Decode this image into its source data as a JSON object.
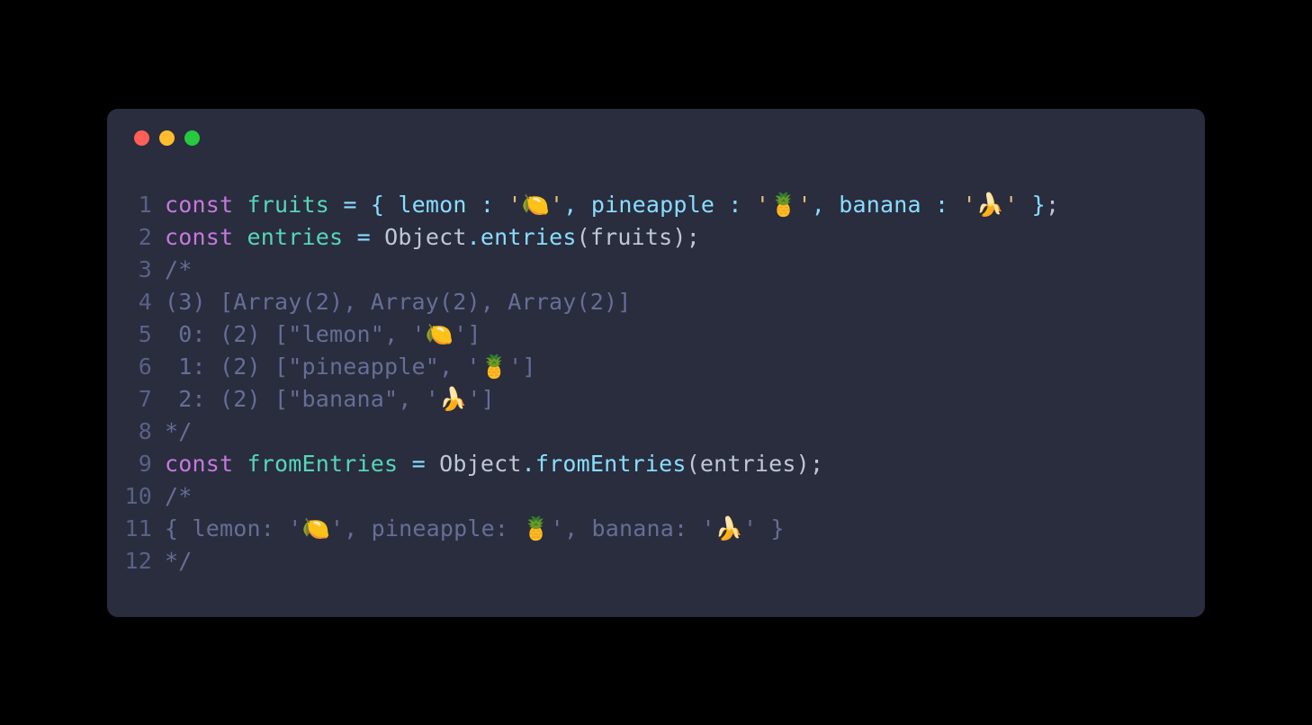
{
  "titlebar": {
    "close": "close",
    "minimize": "minimize",
    "zoom": "zoom"
  },
  "lines": [
    {
      "num": "1"
    },
    {
      "num": "2"
    },
    {
      "num": "3"
    },
    {
      "num": "4"
    },
    {
      "num": "5"
    },
    {
      "num": "6"
    },
    {
      "num": "7"
    },
    {
      "num": "8"
    },
    {
      "num": "9"
    },
    {
      "num": "10"
    },
    {
      "num": "11"
    },
    {
      "num": "12"
    }
  ],
  "tokens": {
    "l1": {
      "const": "const",
      "sp1": " ",
      "fruits": "fruits",
      "sp2": " ",
      "eq": "=",
      "sp3": " ",
      "obrace": "{",
      "sp4": " ",
      "lemon": "lemon",
      "sp5": " ",
      "colon1": ":",
      "sp6": " ",
      "str1": "'🍋'",
      "comma1": ",",
      "sp7": " ",
      "pineapple": "pineapple",
      "sp8": " ",
      "colon2": ":",
      "sp9": " ",
      "str2": "'🍍'",
      "comma2": ",",
      "sp10": " ",
      "banana": "banana",
      "sp11": " ",
      "colon3": ":",
      "sp12": " ",
      "str3": "'🍌'",
      "sp13": " ",
      "cbrace": "}",
      "semi": ";"
    },
    "l2": {
      "const": "const",
      "sp1": " ",
      "entries": "entries",
      "sp2": " ",
      "eq": "=",
      "sp3": " ",
      "object": "Object",
      "dot": ".",
      "method": "entries",
      "oparen": "(",
      "arg": "fruits",
      "cparen": ")",
      "semi": ";"
    },
    "l3": {
      "text": "/*"
    },
    "l4": {
      "text": "(3) [Array(2), Array(2), Array(2)]"
    },
    "l5": {
      "text": " 0: (2) [\"lemon\", '🍋']"
    },
    "l6": {
      "text": " 1: (2) [\"pineapple\", '🍍']"
    },
    "l7": {
      "text": " 2: (2) [\"banana\", '🍌']"
    },
    "l8": {
      "text": "*/"
    },
    "l9": {
      "const": "const",
      "sp1": " ",
      "fromEntries": "fromEntries",
      "sp2": " ",
      "eq": "=",
      "sp3": " ",
      "object": "Object",
      "dot": ".",
      "method": "fromEntries",
      "oparen": "(",
      "arg": "entries",
      "cparen": ")",
      "semi": ";"
    },
    "l10": {
      "text": "/*"
    },
    "l11": {
      "text": "{ lemon: '🍋', pineapple: 🍍', banana: '🍌' }"
    },
    "l12": {
      "text": "*/"
    }
  }
}
